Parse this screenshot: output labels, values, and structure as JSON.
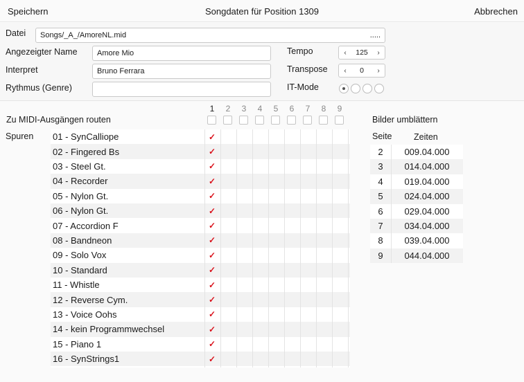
{
  "navbar": {
    "save": "Speichern",
    "title": "Songdaten für Position 1309",
    "cancel": "Abbrechen"
  },
  "form": {
    "datei_label": "Datei",
    "datei_value": "Songs/_A_/AmoreNL.mid",
    "datei_more": ".....",
    "name_label": "Angezeigter Name",
    "name_value": "Amore Mio",
    "interpret_label": "Interpret",
    "interpret_value": "Bruno Ferrara",
    "rhythmus_label": "Rythmus (Genre)",
    "rhythmus_value": "",
    "tempo_label": "Tempo",
    "tempo_value": "125",
    "transpose_label": "Transpose",
    "transpose_value": "0",
    "itmode_label": "IT-Mode",
    "itmode_selected": 1,
    "left_arrow": "‹",
    "right_arrow": "›"
  },
  "routing": {
    "label": "Zu MIDI-Ausgängen routen",
    "columns": [
      "1",
      "2",
      "3",
      "4",
      "5",
      "6",
      "7",
      "8",
      "9"
    ],
    "spuren_label": "Spuren",
    "check_glyph": "✓",
    "tracks": [
      {
        "name": "01 - SynCalliope",
        "outputs": [
          1
        ]
      },
      {
        "name": "02 - Fingered Bs",
        "outputs": [
          1
        ]
      },
      {
        "name": "03 - Steel Gt.",
        "outputs": [
          1
        ]
      },
      {
        "name": "04 - Recorder",
        "outputs": [
          1
        ]
      },
      {
        "name": "05 - Nylon Gt.",
        "outputs": [
          1
        ]
      },
      {
        "name": "06 - Nylon Gt.",
        "outputs": [
          1
        ]
      },
      {
        "name": "07 - Accordion F",
        "outputs": [
          1
        ]
      },
      {
        "name": "08 - Bandneon",
        "outputs": [
          1
        ]
      },
      {
        "name": "09 - Solo Vox",
        "outputs": [
          1
        ]
      },
      {
        "name": "10 - Standard",
        "outputs": [
          1
        ]
      },
      {
        "name": "11 - Whistle",
        "outputs": [
          1
        ]
      },
      {
        "name": "12 - Reverse Cym.",
        "outputs": [
          1
        ]
      },
      {
        "name": "13 - Voice Oohs",
        "outputs": [
          1
        ]
      },
      {
        "name": "14 - kein Programmwechsel",
        "outputs": [
          1
        ]
      },
      {
        "name": "15 - Piano 1",
        "outputs": [
          1
        ]
      },
      {
        "name": "16 - SynStrings1",
        "outputs": [
          1
        ]
      }
    ]
  },
  "pages": {
    "label": "Bilder umblättern",
    "seite_header": "Seite",
    "zeiten_header": "Zeiten",
    "rows": [
      {
        "seite": "2",
        "zeit": "009.04.000"
      },
      {
        "seite": "3",
        "zeit": "014.04.000"
      },
      {
        "seite": "4",
        "zeit": "019.04.000"
      },
      {
        "seite": "5",
        "zeit": "024.04.000"
      },
      {
        "seite": "6",
        "zeit": "029.04.000"
      },
      {
        "seite": "7",
        "zeit": "034.04.000"
      },
      {
        "seite": "8",
        "zeit": "039.04.000"
      },
      {
        "seite": "9",
        "zeit": "044.04.000"
      }
    ]
  },
  "colors": {
    "check": "#d9111b"
  }
}
